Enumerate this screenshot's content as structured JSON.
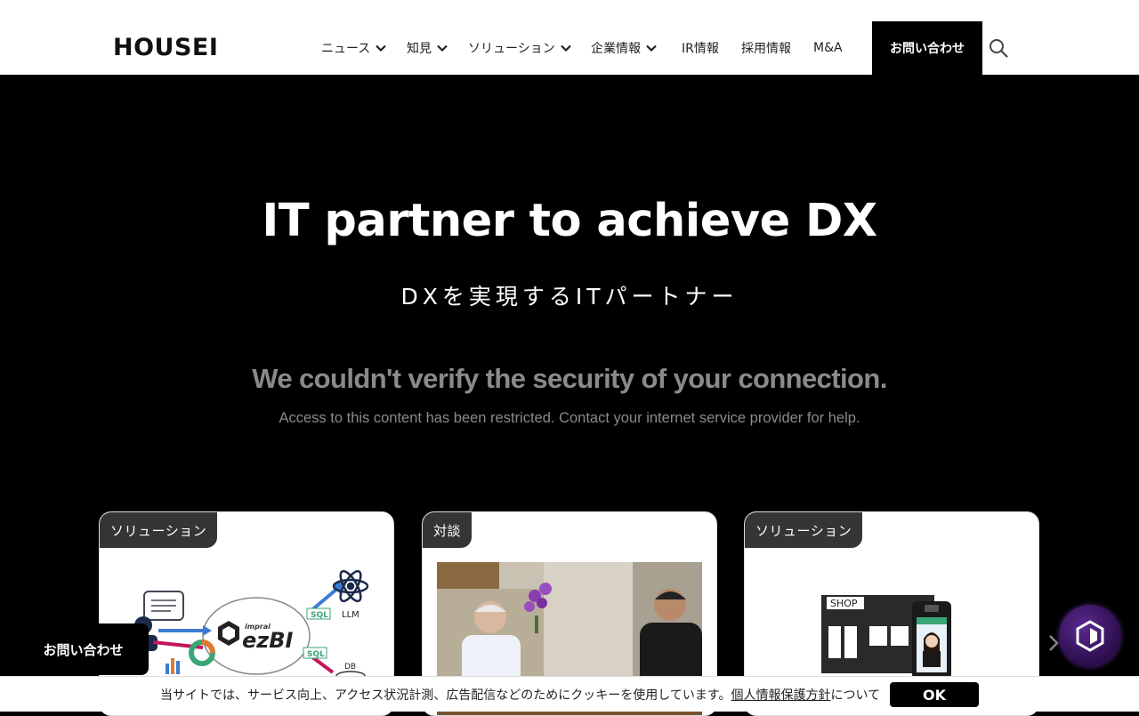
{
  "header": {
    "logo": "HOUSEI",
    "nav": [
      {
        "label": "ニュース",
        "dropdown": true
      },
      {
        "label": "知見",
        "dropdown": true
      },
      {
        "label": "ソリューション",
        "dropdown": true
      },
      {
        "label": "企業情報",
        "dropdown": true
      },
      {
        "label": "IR情報",
        "dropdown": false
      },
      {
        "label": "採用情報",
        "dropdown": false
      },
      {
        "label": "M&A",
        "dropdown": false
      }
    ],
    "contact_label": "お問い合わせ",
    "search_icon": "search-icon"
  },
  "hero": {
    "title": "IT partner to achieve DX",
    "subtitle": "DXを実現するITパートナー"
  },
  "error": {
    "title": "We couldn't verify the security of your connection.",
    "message": "Access to this content has been restricted. Contact your internet service provider for help."
  },
  "cards": [
    {
      "tag": "ソリューション",
      "image_text": {
        "brand_small": "imprai",
        "brand": "ezBI",
        "sql1": "SQL",
        "sql2": "SQL",
        "llm": "LLM",
        "db": "DB"
      }
    },
    {
      "tag": "対談"
    },
    {
      "tag": "ソリューション",
      "image_text": {
        "shop": "SHOP"
      }
    }
  ],
  "float_contact_label": "お問い合わせ",
  "cookie": {
    "text_before": "当サイトでは、サービス向上、アクセス状況計測、広告配信などのためにクッキーを使用しています。",
    "link": "個人情報保護方針",
    "text_after": "について",
    "ok_label": "OK"
  },
  "colors": {
    "background": "#000000",
    "header": "#ffffff",
    "tag": "#353535",
    "error_text": "#8a8a8a",
    "chat_bubble": "#3d1866"
  }
}
